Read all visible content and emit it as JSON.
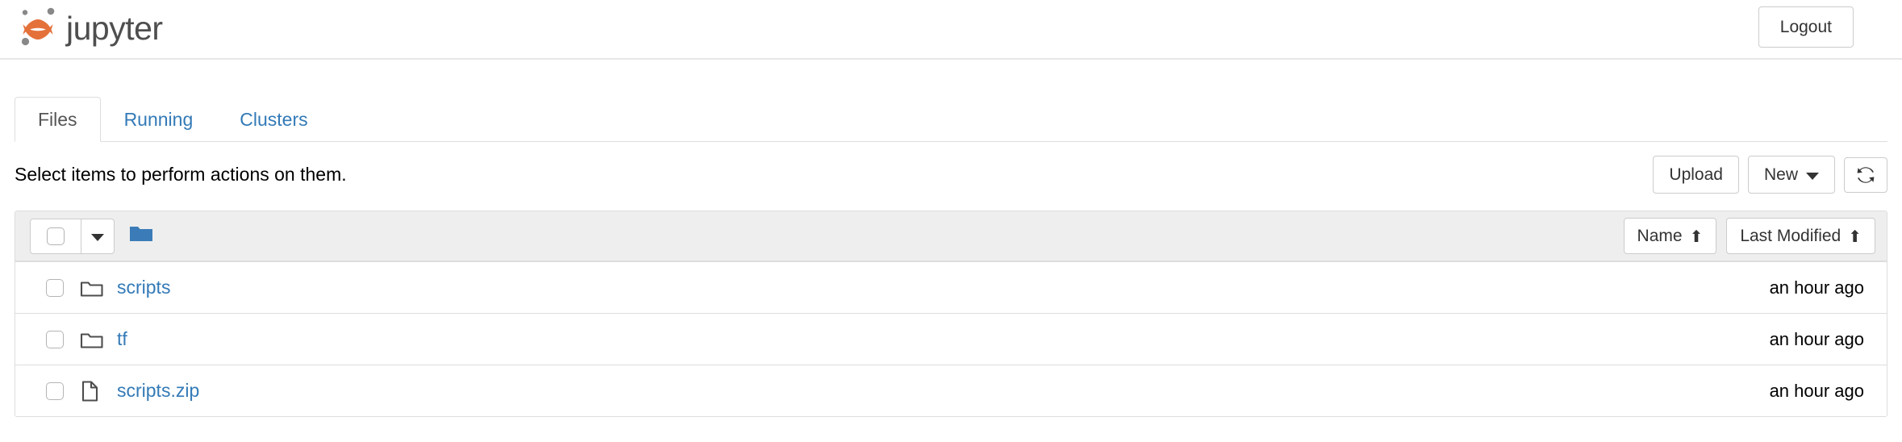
{
  "header": {
    "brand_text": "jupyter",
    "brand_logo_icon": "jupyter-logo-icon",
    "logout_label": "Logout"
  },
  "tabs": [
    {
      "label": "Files",
      "active": true
    },
    {
      "label": "Running",
      "active": false
    },
    {
      "label": "Clusters",
      "active": false
    }
  ],
  "action_bar": {
    "select_hint": "Select items to perform actions on them.",
    "upload_label": "Upload",
    "new_label": "New",
    "new_caret_icon": "caret-down-icon",
    "refresh_icon": "refresh-icon"
  },
  "list_header": {
    "select_all_icon": "checkbox-icon",
    "select_all_caret_icon": "caret-down-icon",
    "breadcrumb_root_icon": "folder-filled-icon",
    "sort_name_label": "Name",
    "sort_name_arrow": "⬆",
    "sort_modified_label": "Last Modified",
    "sort_modified_arrow": "⬆"
  },
  "files": [
    {
      "checkbox_icon": "checkbox-icon",
      "type_icon": "folder-outline-icon",
      "name": "scripts",
      "modified": "an hour ago"
    },
    {
      "checkbox_icon": "checkbox-icon",
      "type_icon": "folder-outline-icon",
      "name": "tf",
      "modified": "an hour ago"
    },
    {
      "checkbox_icon": "checkbox-icon",
      "type_icon": "file-outline-icon",
      "name": "scripts.zip",
      "modified": "an hour ago"
    }
  ],
  "colors": {
    "link": "#337ab7",
    "brand_orange": "#e4713a",
    "brand_gray": "#888888",
    "folder_blue": "#3b7cb8",
    "header_bg": "#eeeeee",
    "border": "#dddddd"
  }
}
